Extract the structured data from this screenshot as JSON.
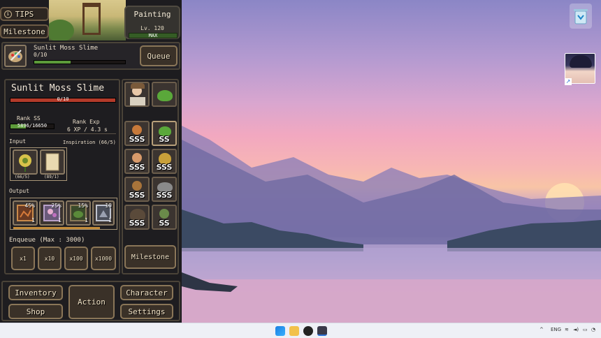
{
  "game": {
    "tips_label": "TIPS",
    "milestone_tab_label": "Milestone",
    "skill_title": "Painting",
    "level_text": "Lv. 120",
    "level_max": "MAX",
    "current_task": {
      "name": "Sunlit Moss Slime",
      "progress": "0/10",
      "progress_fraction": 0.0
    },
    "queue_label": "Queue",
    "recipe": {
      "name": "Sunlit Moss Slime",
      "progress": "0/10",
      "rank_label": "Rank SS",
      "rank_value": "5896/16650",
      "rank_fraction": 0.354,
      "rank_exp_label": "Rank Exp",
      "rank_exp_value": "6 XP / 4.3 s",
      "input_label": "Input",
      "inspiration_label": "Inspiration (66/5)",
      "inputs": [
        {
          "name": "sun-flower-icon",
          "count": "(66/5)"
        },
        {
          "name": "paper-icon",
          "count": "(89/1)"
        }
      ],
      "output_label": "Output",
      "outputs": [
        {
          "name": "painting-frame-icon",
          "pct": "45%",
          "count": "1"
        },
        {
          "name": "flower-painting-icon",
          "pct": "25%",
          "count": "1"
        },
        {
          "name": "moss-painting-icon",
          "pct": "15%",
          "count": "1"
        },
        {
          "name": "silver-painting-icon",
          "pct": "10",
          "count": "1"
        }
      ],
      "enqueue_label": "Enqueue (Max : 3000)",
      "enqueue_buttons": [
        "x1",
        "x10",
        "x100",
        "x1000"
      ]
    },
    "characters": [
      "SSS",
      "SS",
      "SSS",
      "SSS",
      "SSS",
      "SSS",
      "SSS",
      "SS"
    ],
    "milestone_button": "Milestone",
    "nav": {
      "inventory": "Inventory",
      "shop": "Shop",
      "action": "Action",
      "character": "Character",
      "settings": "Settings"
    }
  },
  "taskbar": {
    "language": "ENG"
  },
  "colors": {
    "bar_green": "#5c9a3a",
    "bar_red": "#b33a2a",
    "frame": "#8a7658"
  }
}
